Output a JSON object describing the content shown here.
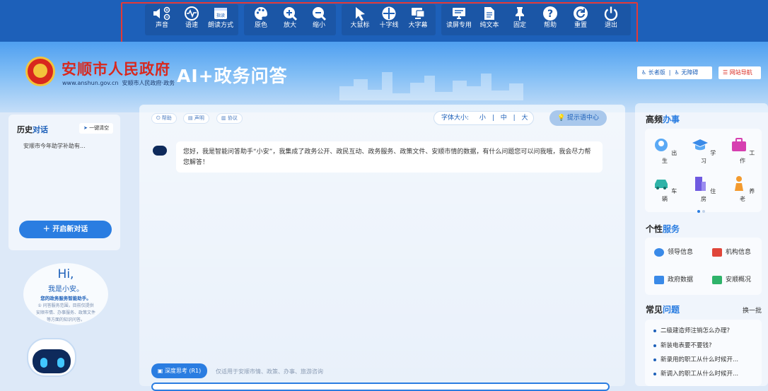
{
  "toolbar": {
    "buttons": [
      {
        "label": "声音",
        "icon": "speaker-mute-icon"
      },
      {
        "label": "语速",
        "icon": "speed-wave-icon"
      },
      {
        "label": "朗读方式",
        "icon": "read-mode-icon"
      },
      {
        "label": "原色",
        "icon": "palette-icon"
      },
      {
        "label": "放大",
        "icon": "zoom-in-icon"
      },
      {
        "label": "缩小",
        "icon": "zoom-out-icon"
      },
      {
        "label": "大鼠标",
        "icon": "cursor-icon"
      },
      {
        "label": "十字线",
        "icon": "crosshair-icon"
      },
      {
        "label": "大字幕",
        "icon": "monitor-icon"
      },
      {
        "label": "读屏专用",
        "icon": "screen-reader-icon"
      },
      {
        "label": "纯文本",
        "icon": "document-icon"
      },
      {
        "label": "固定",
        "icon": "pin-icon"
      },
      {
        "label": "帮助",
        "icon": "help-icon"
      },
      {
        "label": "重置",
        "icon": "reset-icon"
      },
      {
        "label": "退出",
        "icon": "power-icon"
      }
    ],
    "read_mode_badge": "指读",
    "colors": {
      "bar": "#1d60b9",
      "group": "#1b56a6",
      "highlight": "#e53935"
    }
  },
  "header": {
    "site_title": "安顺市人民政府",
    "site_url": "www.anshun.gov.cn",
    "site_sub": "安顺市人民政府·政务",
    "ai_title": "AI+政务问答",
    "links": {
      "elder": "长者版",
      "barrier_free": "无障碍",
      "site_nav": "网站导航"
    }
  },
  "left": {
    "history_title_a": "历史",
    "history_title_b": "对话",
    "quick_button": "一键清空",
    "history_items": [
      "安顺市今年助学补助有..."
    ],
    "new_chat": "＋  开启新对话",
    "bubble": {
      "hi": "Hi,",
      "name": "我是小安。",
      "role": "您的政务服务智能助手。",
      "desc1": "① 问答服务范围，目前仅提供",
      "desc2": "安顺市情、办事服务、政策文件",
      "desc3": "等方面的知识问答。"
    }
  },
  "main": {
    "pills": {
      "help": "帮助",
      "statement": "声明",
      "agreement": "协议"
    },
    "font_size_label": "字体大小:",
    "font_sizes": {
      "small": "小",
      "mid": "中",
      "large": "大"
    },
    "hint_center": "提示语中心",
    "greeting": "您好，我是智能问答助手“小安”，我集成了政务公开、政民互动、政务服务、政策文件、安顺市情的数据，有什么问题您可以问我哦，我会尽力帮您解答！",
    "deep_think": "深度思考 (R1)",
    "deep_hint": "仅适用于安顺市情、政策、办事、旅游咨询"
  },
  "right": {
    "high_freq_a": "高频",
    "high_freq_b": "办事",
    "hf_items": [
      {
        "label": "出生",
        "icon": "baby-icon"
      },
      {
        "label": "学习",
        "icon": "graduation-cap-icon"
      },
      {
        "label": "工作",
        "icon": "briefcase-icon"
      },
      {
        "label": "车辆",
        "icon": "car-icon"
      },
      {
        "label": "住房",
        "icon": "building-icon"
      },
      {
        "label": "养老",
        "icon": "elderly-icon"
      }
    ],
    "personal_a": "个性",
    "personal_b": "服务",
    "services": [
      {
        "label": "领导信息",
        "icon": "leader-icon"
      },
      {
        "label": "机构信息",
        "icon": "institution-icon"
      },
      {
        "label": "政府数据",
        "icon": "data-chart-icon"
      },
      {
        "label": "安顺概况",
        "icon": "overview-icon"
      }
    ],
    "common_a": "常见",
    "common_b": "问题",
    "swap": "换一批",
    "questions": [
      "二级建造师注销怎么办理?",
      "新装电表要不要钱?",
      "新录用的职工从什么时候开...",
      "新调入的职工从什么时候开..."
    ]
  }
}
